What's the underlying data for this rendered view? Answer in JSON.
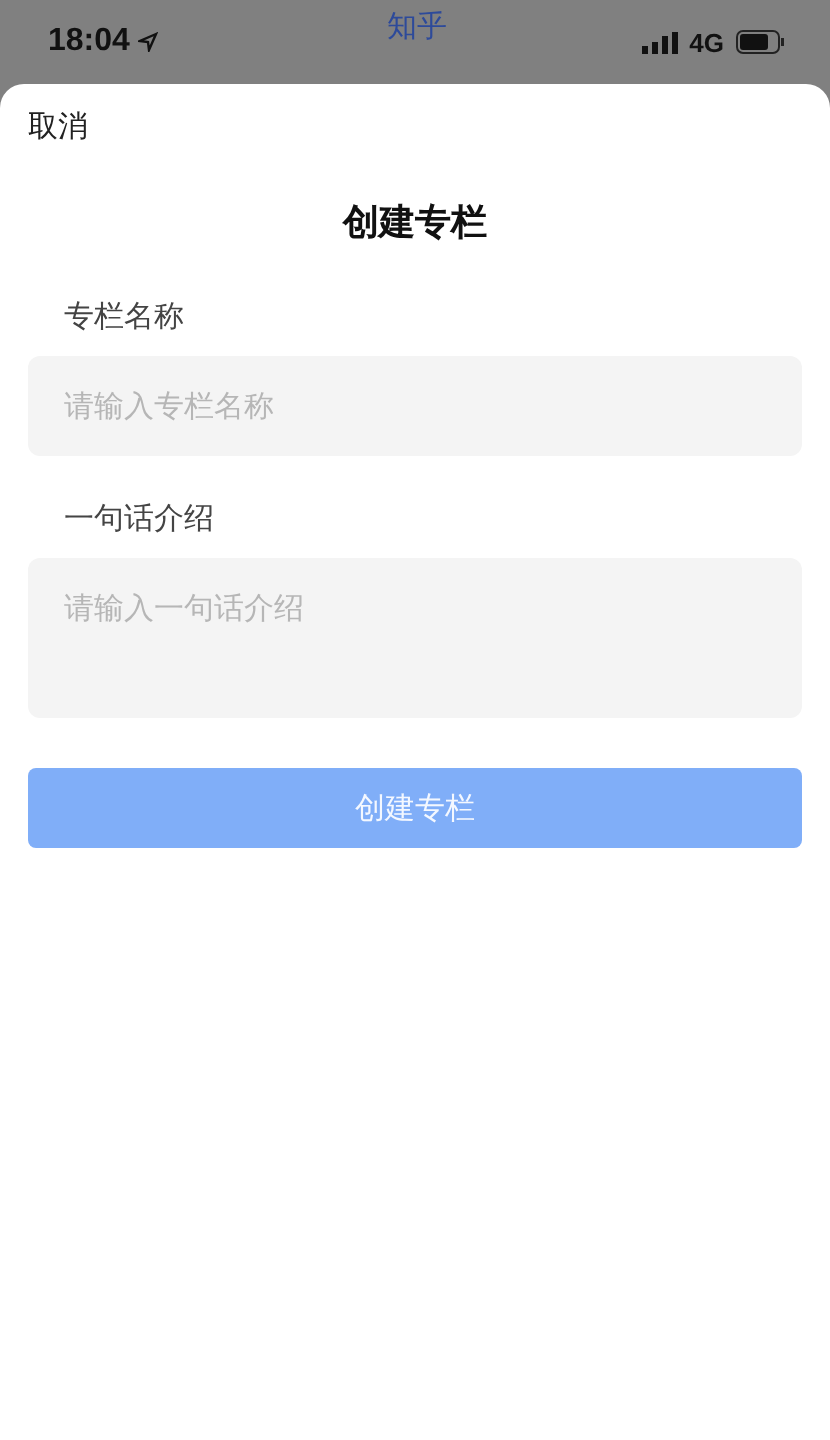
{
  "status_bar": {
    "time": "18:04",
    "app": "知乎",
    "network": "4G"
  },
  "sheet": {
    "cancel": "取消",
    "title": "创建专栏"
  },
  "fields": [
    {
      "kind": "input",
      "label": "专栏名称",
      "placeholder": "请输入专栏名称"
    },
    {
      "kind": "textarea",
      "label": "一句话介绍",
      "placeholder": "请输入一句话介绍"
    }
  ],
  "submit": {
    "label": "创建专栏",
    "disabled": true
  }
}
